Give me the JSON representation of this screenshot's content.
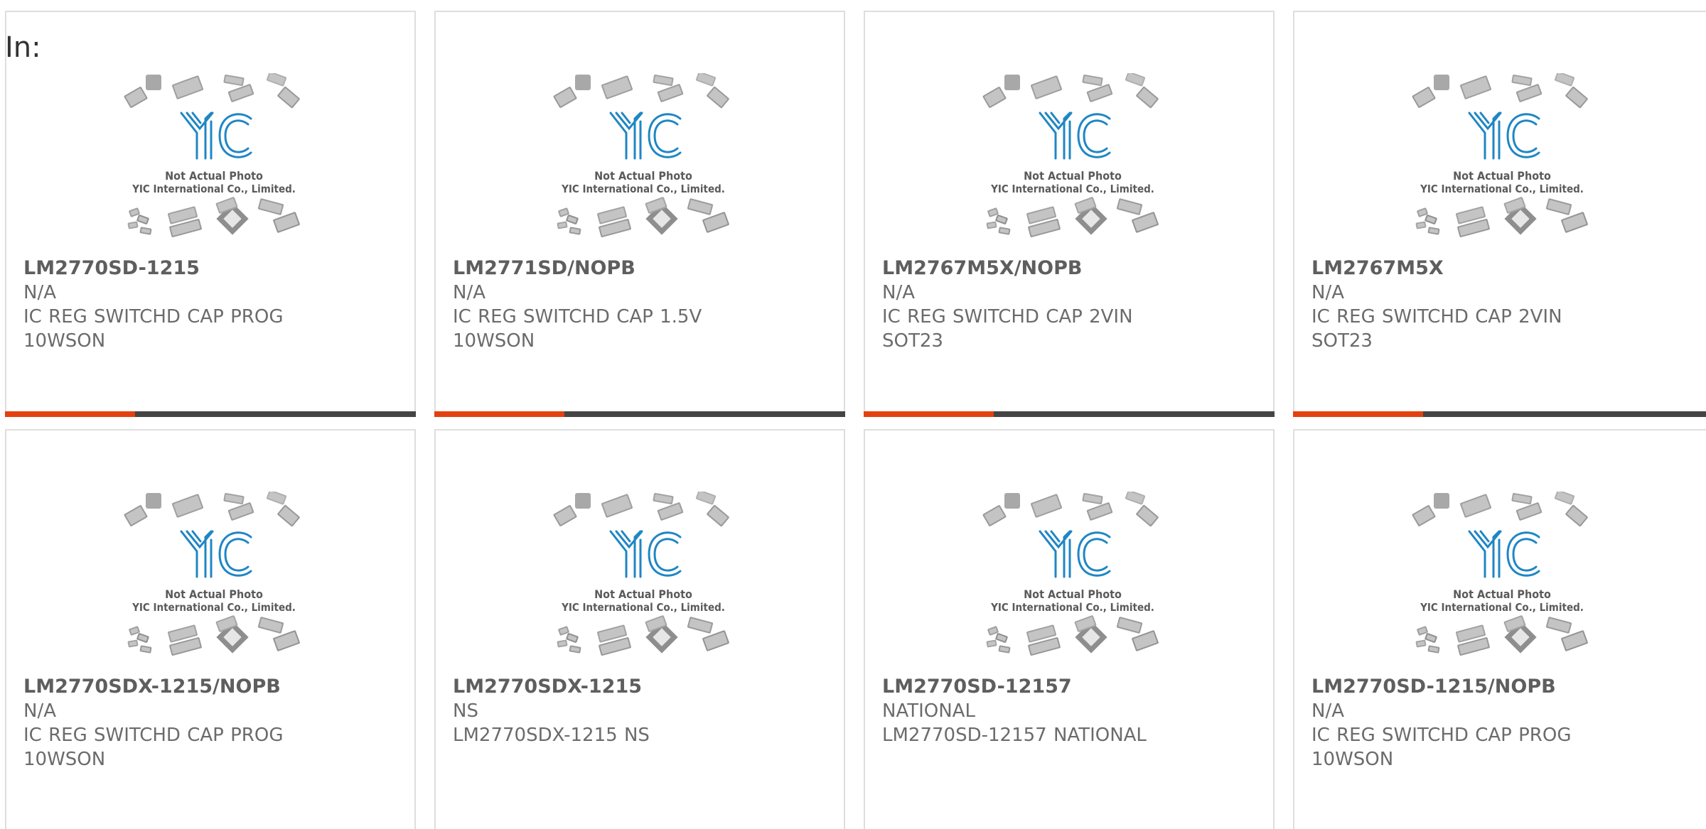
{
  "header": {
    "label": "In:"
  },
  "colors": {
    "accent": "#e3410f",
    "bar": "#444444",
    "logo": "#1f86c4"
  },
  "photo": {
    "logo_text": "YIC",
    "caption_line1": "Not Actual Photo",
    "caption_line2": "YIC International Co., Limited."
  },
  "cards": [
    {
      "part": "LM2770SD-1215",
      "brand": "N/A",
      "desc_line1": "IC REG SWITCHD CAP PROG",
      "desc_line2": "10WSON",
      "has_bar": true
    },
    {
      "part": "LM2771SD/NOPB",
      "brand": "N/A",
      "desc_line1": "IC REG SWITCHD CAP 1.5V",
      "desc_line2": "10WSON",
      "has_bar": true
    },
    {
      "part": "LM2767M5X/NOPB",
      "brand": "N/A",
      "desc_line1": "IC REG SWITCHD CAP 2VIN",
      "desc_line2": "SOT23",
      "has_bar": true
    },
    {
      "part": "LM2767M5X",
      "brand": "N/A",
      "desc_line1": "IC REG SWITCHD CAP 2VIN",
      "desc_line2": "SOT23",
      "has_bar": true
    },
    {
      "part": "LM2770SDX-1215/NOPB",
      "brand": "N/A",
      "desc_line1": "IC REG SWITCHD CAP PROG",
      "desc_line2": "10WSON",
      "has_bar": false
    },
    {
      "part": "LM2770SDX-1215",
      "brand": "NS",
      "desc_line1": "LM2770SDX-1215 NS",
      "desc_line2": "",
      "has_bar": false
    },
    {
      "part": "LM2770SD-12157",
      "brand": "NATIONAL",
      "desc_line1": "LM2770SD-12157 NATIONAL",
      "desc_line2": "",
      "has_bar": false
    },
    {
      "part": "LM2770SD-1215/NOPB",
      "brand": "N/A",
      "desc_line1": "IC REG SWITCHD CAP PROG",
      "desc_line2": "10WSON",
      "has_bar": false
    }
  ]
}
